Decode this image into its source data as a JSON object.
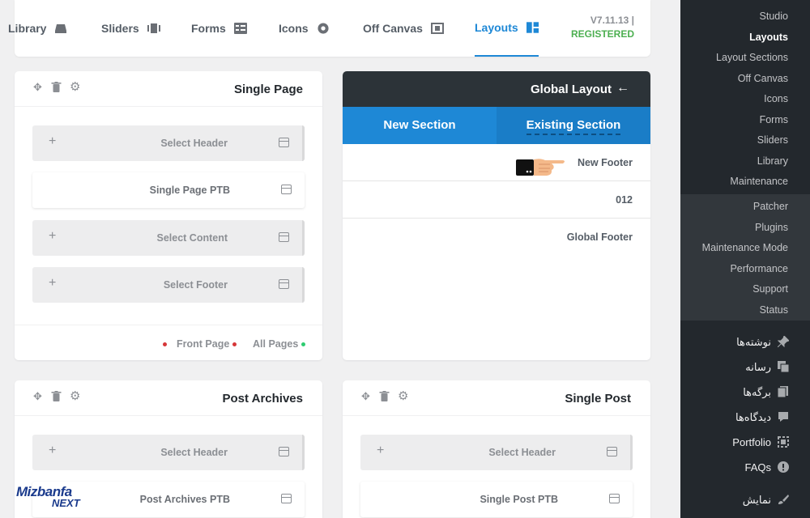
{
  "topnav": {
    "tabs": [
      {
        "label": "Library",
        "icon": "library-icon"
      },
      {
        "label": "Sliders",
        "icon": "sliders-icon"
      },
      {
        "label": "Forms",
        "icon": "forms-icon"
      },
      {
        "label": "Icons",
        "icon": "icons-icon"
      },
      {
        "label": "Off Canvas",
        "icon": "off-canvas-icon"
      },
      {
        "label": "Layouts",
        "icon": "layouts-icon",
        "active": true
      }
    ],
    "version": "V7.11.13 |",
    "status": "REGISTERED",
    "accent": "#1e88d6",
    "status_color": "#4caf50"
  },
  "single_page": {
    "title": "Single Page",
    "slots": [
      "Select Header",
      "Single Page PTB",
      "Select Content",
      "Select Footer"
    ],
    "front_page": "Front Page",
    "all_pages": "All Pages"
  },
  "global_layout": {
    "title": "Global Layout",
    "tab_new": "New Section",
    "tab_existing": "Existing Section",
    "items": [
      "New Footer",
      "012",
      "Global Footer"
    ]
  },
  "post_archives": {
    "title": "Post Archives",
    "slots": [
      "Select Header",
      "Post Archives PTB"
    ]
  },
  "single_post": {
    "title": "Single Post",
    "slots": [
      "Select Header",
      "Single Post PTB"
    ]
  },
  "sidebar": {
    "sub_top": [
      "Studio",
      "Layouts",
      "Layout Sections",
      "Off Canvas",
      "Icons",
      "Forms",
      "Sliders",
      "Library",
      "Maintenance"
    ],
    "sub_bottom": [
      "Patcher",
      "Plugins",
      "Maintenance Mode",
      "Performance",
      "Support",
      "Status"
    ],
    "menu": [
      {
        "label": "نوشته‌ها",
        "icon": "pin-icon"
      },
      {
        "label": "رسانه",
        "icon": "media-icon"
      },
      {
        "label": "برگه‌ها",
        "icon": "pages-icon"
      },
      {
        "label": "دیدگاه‌ها",
        "icon": "comments-icon"
      },
      {
        "label": "Portfolio",
        "icon": "portfolio-icon"
      },
      {
        "label": "FAQs",
        "icon": "info-icon"
      },
      {
        "label": "نمایش",
        "icon": "appearance-icon"
      }
    ]
  },
  "logo": {
    "line1": "Mizbanfa",
    "line2": "NEXT"
  }
}
